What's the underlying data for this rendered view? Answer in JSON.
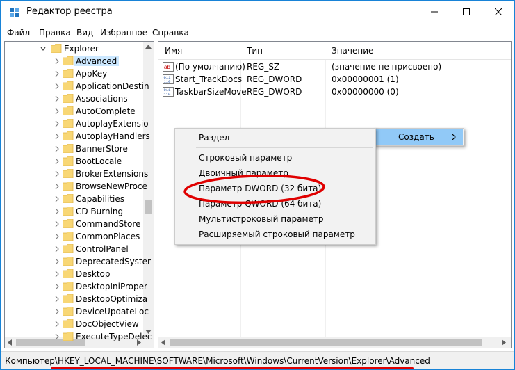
{
  "window": {
    "title": "Редактор реестра",
    "accent": "#1883d7"
  },
  "menu": [
    "Файл",
    "Правка",
    "Вид",
    "Избранное",
    "Справка"
  ],
  "tree": {
    "items": [
      {
        "label": "Explorer",
        "expanded": true
      },
      {
        "label": "Advanced",
        "selected": true
      },
      {
        "label": "AppKey"
      },
      {
        "label": "ApplicationDestin"
      },
      {
        "label": "Associations"
      },
      {
        "label": "AutoComplete"
      },
      {
        "label": "AutoplayExtensio"
      },
      {
        "label": "AutoplayHandlers"
      },
      {
        "label": "BannerStore"
      },
      {
        "label": "BootLocale"
      },
      {
        "label": "BrokerExtensions"
      },
      {
        "label": "BrowseNewProce"
      },
      {
        "label": "Capabilities"
      },
      {
        "label": "CD Burning"
      },
      {
        "label": "CommandStore"
      },
      {
        "label": "CommonPlaces"
      },
      {
        "label": "ControlPanel"
      },
      {
        "label": "DeprecatedSyster"
      },
      {
        "label": "Desktop"
      },
      {
        "label": "DesktopIniProper"
      },
      {
        "label": "DesktopOptimiza"
      },
      {
        "label": "DeviceUpdateLoc"
      },
      {
        "label": "DocObjectView"
      },
      {
        "label": "ExecuteTypeDelec"
      }
    ]
  },
  "list": {
    "columns": [
      "Имя",
      "Тип",
      "Значение"
    ],
    "rows": [
      {
        "name": "(По умолчанию)",
        "type": "REG_SZ",
        "value": "(значение не присвоено)",
        "icon": "string-value-icon"
      },
      {
        "name": "Start_TrackDocs",
        "type": "REG_DWORD",
        "value": "0x00000001 (1)",
        "icon": "dword-value-icon"
      },
      {
        "name": "TaskbarSizeMove",
        "type": "REG_DWORD",
        "value": "0x00000000 (0)",
        "icon": "dword-value-icon"
      }
    ]
  },
  "context_menu": {
    "create_label": "Создать"
  },
  "submenu": {
    "items": [
      "Раздел",
      "Строковый параметр",
      "Двоичный параметр",
      "Параметр DWORD (32 бита)",
      "Параметр QWORD (64 бита)",
      "Мультистроковый параметр",
      "Расширяемый строковый параметр"
    ],
    "highlighted": "Параметр DWORD (32 бита)",
    "highlight_color": "#e00000"
  },
  "status": {
    "path": "Компьютер\\HKEY_LOCAL_MACHINE\\SOFTWARE\\Microsoft\\Windows\\CurrentVersion\\Explorer\\Advanced"
  }
}
